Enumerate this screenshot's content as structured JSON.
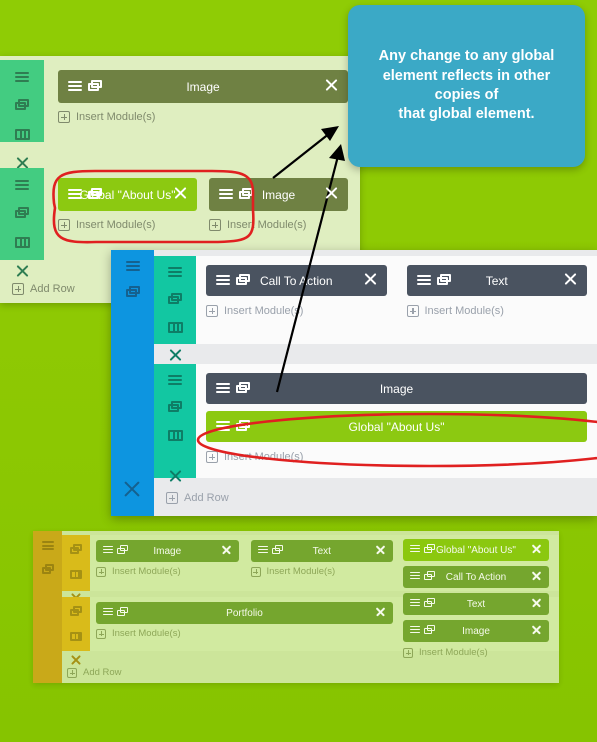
{
  "tooltip": {
    "text": "Any change to any global element reflects in other copies of\nthat global element.",
    "line1": "Any change to any global",
    "line2": "element reflects in other",
    "line3": "copies of",
    "line4": "that global element.",
    "bg_color": "#3ba9c6"
  },
  "labels": {
    "insert_modules": "Insert Module(s)",
    "add_row": "Add Row"
  },
  "colors": {
    "page_background": "#8ec903",
    "global_module": "#8cc911",
    "annotation_red": "#e02020",
    "panel1_section": "#43cc81",
    "panel2_section": "#12c7a2",
    "panel2_outer": "#0d95e0",
    "panel2_module": "#4a5360",
    "panel3_section": "#e0bb1d",
    "panel3_outer": "#cfa71c",
    "panel3_module": "#74a432"
  },
  "icons": {
    "hamburger": "hamburger-icon",
    "clone": "clone-icon",
    "columns": "columns-icon",
    "close": "close-icon",
    "plus": "plus-icon"
  },
  "panel1": {
    "rows": [
      {
        "columns": [
          {
            "modules": [
              {
                "label": "Image",
                "global": false,
                "has_close": true
              }
            ]
          }
        ]
      },
      {
        "columns": [
          {
            "modules": [
              {
                "label": "Global \"About Us\"",
                "global": true,
                "has_close": true
              }
            ]
          },
          {
            "modules": [
              {
                "label": "Image",
                "global": false,
                "has_close": true
              }
            ]
          }
        ]
      }
    ]
  },
  "panel2": {
    "rows": [
      {
        "columns": [
          {
            "modules": [
              {
                "label": "Call To Action",
                "global": false,
                "has_close": true
              }
            ]
          },
          {
            "modules": [
              {
                "label": "Text",
                "global": false,
                "has_close": true
              }
            ]
          }
        ]
      },
      {
        "columns": [
          {
            "modules": [
              {
                "label": "Image",
                "global": false,
                "has_close": false
              },
              {
                "label": "Global \"About Us\"",
                "global": true,
                "has_close": false
              }
            ]
          }
        ]
      }
    ]
  },
  "panel3": {
    "rows": [
      {
        "columns": [
          {
            "modules": [
              {
                "label": "Image",
                "global": false,
                "has_close": true
              }
            ]
          },
          {
            "modules": [
              {
                "label": "Text",
                "global": false,
                "has_close": true
              }
            ]
          }
        ]
      },
      {
        "columns": [
          {
            "modules": [
              {
                "label": "Portfolio",
                "global": false,
                "has_close": true
              }
            ]
          }
        ]
      }
    ],
    "right_column": {
      "modules": [
        {
          "label": "Global \"About Us\"",
          "global": true,
          "has_close": true
        },
        {
          "label": "Call To Action",
          "global": false,
          "has_close": true
        },
        {
          "label": "Text",
          "global": false,
          "has_close": true
        },
        {
          "label": "Image",
          "global": false,
          "has_close": true
        }
      ]
    }
  },
  "annotations": {
    "highlight_count": 2,
    "arrow_count": 2,
    "highlight_1_target": "Global \"About Us\" module in panel 1",
    "highlight_2_target": "Global \"About Us\" module in panel 2"
  }
}
